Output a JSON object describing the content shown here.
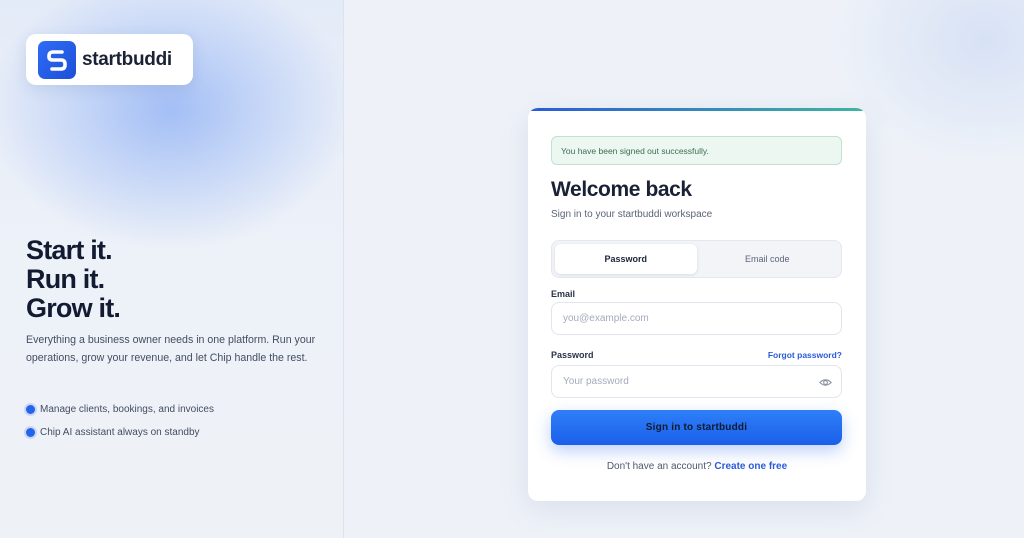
{
  "brand": {
    "name": "startbuddi",
    "logo_icon": "startbuddi-logo-icon",
    "accent_color": "#2563eb"
  },
  "hero": {
    "headline": [
      "Start it.",
      "Run it.",
      "Grow it."
    ],
    "lead": "Everything a business owner needs in one platform. Run your operations, grow your revenue, and let Chip handle the rest.",
    "bullets": [
      "Manage clients, bookings, and invoices",
      "Chip AI assistant always on standby"
    ]
  },
  "signin": {
    "notice": "You have been signed out successfully.",
    "title": "Welcome back",
    "subtitle": "Sign in to your startbuddi workspace",
    "tabs": [
      {
        "label": "Password",
        "active": true
      },
      {
        "label": "Email code",
        "active": false
      }
    ],
    "email": {
      "label": "Email",
      "placeholder": "you@example.com",
      "value": ""
    },
    "password": {
      "label": "Password",
      "placeholder": "Your password",
      "value": "",
      "toggle_icon": "eye-icon"
    },
    "forgot_label": "Forgot password?",
    "submit_label": "Sign in to startbuddi",
    "signup_prompt": "Don't have an account?",
    "signup_link": "Create one free"
  }
}
